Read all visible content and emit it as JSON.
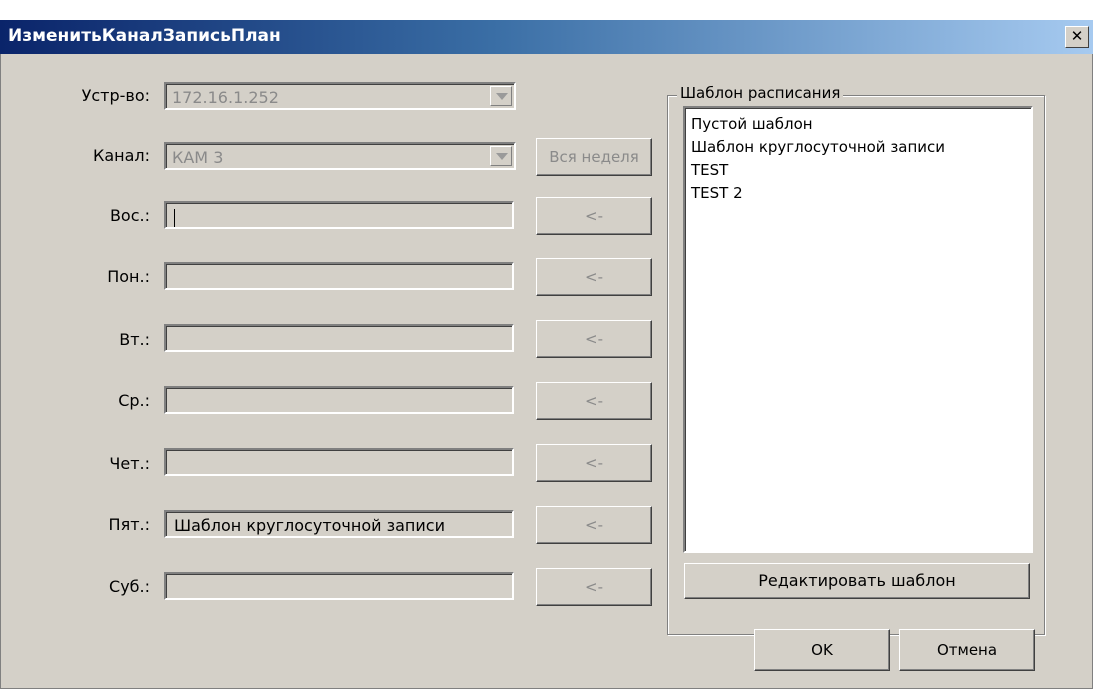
{
  "window": {
    "title": "ИзменитьКаналЗаписьПлан",
    "close_glyph": "✕"
  },
  "device": {
    "label": "Устр-во:",
    "value": "172.16.1.252"
  },
  "channel": {
    "label": "Канал:",
    "value": "КАМ 3"
  },
  "whole_week_button": "Вся неделя",
  "arrow_button_label": "<-",
  "days": [
    {
      "label": "Вос.:",
      "value": ""
    },
    {
      "label": "Пон.:",
      "value": ""
    },
    {
      "label": "Вт.:",
      "value": ""
    },
    {
      "label": "Ср.:",
      "value": ""
    },
    {
      "label": "Чет.:",
      "value": ""
    },
    {
      "label": "Пят.:",
      "value": "Шаблон круглосуточной записи"
    },
    {
      "label": "Суб.:",
      "value": ""
    }
  ],
  "templates": {
    "group_label": "Шаблон расписания",
    "items": [
      "Пустой шаблон",
      "Шаблон круглосуточной записи",
      "TEST",
      "TEST 2"
    ],
    "edit_button": "Редактировать шаблон"
  },
  "footer": {
    "ok": "OK",
    "cancel": "Отмена"
  }
}
